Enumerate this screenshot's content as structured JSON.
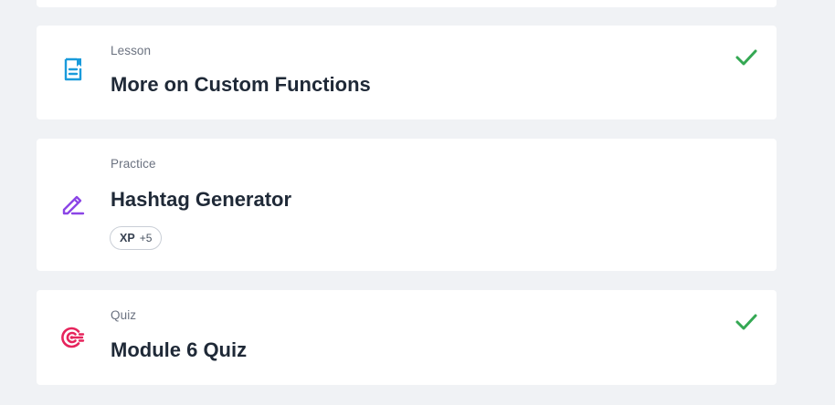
{
  "items": [
    {
      "kind": "Lesson",
      "title": "More on Custom Functions",
      "icon": "lesson-document-icon",
      "icon_color": "#1a9bdb",
      "completed": true
    },
    {
      "kind": "Practice",
      "title": "Hashtag Generator",
      "icon": "practice-pencil-icon",
      "icon_color": "#8b45e6",
      "completed": false,
      "xp_label": "XP",
      "xp_value": "+5"
    },
    {
      "kind": "Quiz",
      "title": "Module 6 Quiz",
      "icon": "quiz-target-icon",
      "icon_color": "#e6245c",
      "completed": true
    }
  ],
  "colors": {
    "background": "#f0f2f5",
    "card": "#ffffff",
    "check": "#34a853",
    "kind_text": "#6b7280",
    "title_text": "#1f2937"
  }
}
